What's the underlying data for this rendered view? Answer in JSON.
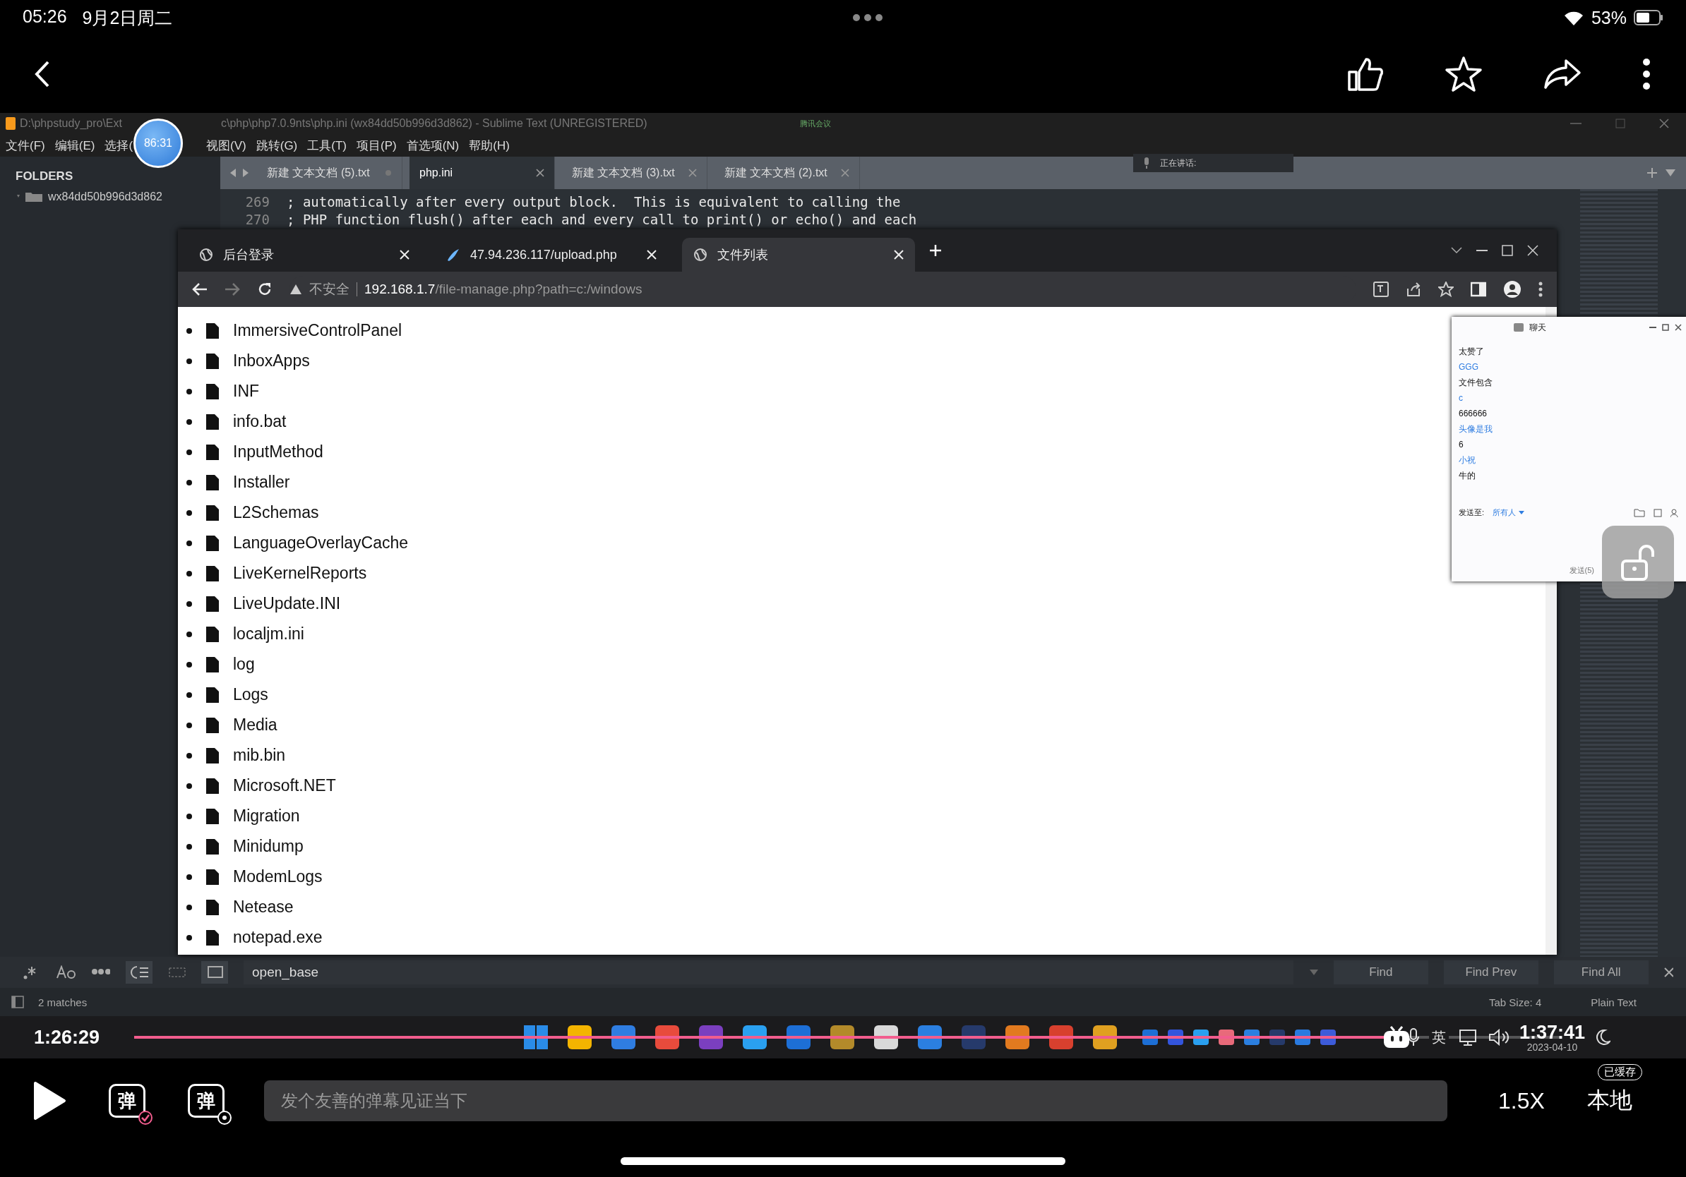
{
  "status_bar": {
    "time": "05:26",
    "date": "9月2日周二",
    "battery": "53%"
  },
  "editor": {
    "title_left": "D:\\phpstudy_pro\\Ext",
    "title_right": "c\\php\\php7.0.9nts\\php.ini (wx84dd50b996d3d862) - Sublime Text (UNREGISTERED)",
    "meeting": "腾讯会议",
    "menu": [
      "文件(F)",
      "编辑(E)",
      "选择(",
      "视图(V)",
      "跳转(G)",
      "工具(T)",
      "项目(P)",
      "首选项(N)",
      "帮助(H)"
    ],
    "folders_heading": "FOLDERS",
    "folder": "wx84dd50b996d3d862",
    "tabs": [
      {
        "label": "新建 文本文档 (5).txt",
        "selected": false,
        "dirty": true
      },
      {
        "label": "php.ini",
        "selected": true,
        "dirty": false
      },
      {
        "label": "新建 文本文档 (3).txt",
        "selected": false,
        "dirty": false
      },
      {
        "label": "新建 文本文档 (2).txt",
        "selected": false,
        "dirty": false
      }
    ],
    "speaking": "正在讲话:",
    "code_lines": [
      {
        "number": "269",
        "text": "; automatically after every output block.  This is equivalent to calling the"
      },
      {
        "number": "270",
        "text": "; PHP function flush() after each and every call to print() or echo() and each"
      }
    ],
    "find": {
      "value": "open_base",
      "buttons": [
        "Find",
        "Find Prev",
        "Find All"
      ]
    },
    "status": {
      "matches": "2 matches",
      "tab_size": "Tab Size: 4",
      "syntax": "Plain Text"
    }
  },
  "timer_bubble": "86:31",
  "browser": {
    "tabs": [
      {
        "title": "后台登录",
        "kind": "globe",
        "selected": false
      },
      {
        "title": "47.94.236.117/upload.php",
        "kind": "fish",
        "selected": false
      },
      {
        "title": "文件列表",
        "kind": "globe",
        "selected": true
      }
    ],
    "security": "不安全",
    "url_host": "192.168.1.7",
    "url_path": "/file-manage.php?path=c:/windows",
    "files": [
      "ImmersiveControlPanel",
      "InboxApps",
      "INF",
      "info.bat",
      "InputMethod",
      "Installer",
      "L2Schemas",
      "LanguageOverlayCache",
      "LiveKernelReports",
      "LiveUpdate.INI",
      "localjm.ini",
      "log",
      "Logs",
      "Media",
      "mib.bin",
      "Microsoft.NET",
      "Migration",
      "Minidump",
      "ModemLogs",
      "Netease",
      "notepad.exe"
    ]
  },
  "chat": {
    "title": "聊天",
    "messages": [
      {
        "kind": "message",
        "text": "太赞了"
      },
      {
        "kind": "name",
        "text": "GGG"
      },
      {
        "kind": "message",
        "text": "文件包含"
      },
      {
        "kind": "name",
        "text": "c"
      },
      {
        "kind": "message",
        "text": "666666"
      },
      {
        "kind": "name",
        "text": "头像是我"
      },
      {
        "kind": "message",
        "text": "6"
      },
      {
        "kind": "name",
        "text": "小祝"
      },
      {
        "kind": "message",
        "text": "牛的"
      }
    ],
    "send_to_label": "发送至:",
    "recipient": "所有人",
    "send_button": "发送(5)"
  },
  "taskbar": {
    "ime": "英",
    "date": "2023-04-10"
  },
  "playback": {
    "elapsed": "1:26:29",
    "total": "1:37:41",
    "level": 0.885
  },
  "controls": {
    "danmaku_buttons": [
      {
        "glyph": "弹",
        "kind": "toggle"
      },
      {
        "glyph": "弹",
        "kind": "settings"
      }
    ],
    "danmaku_placeholder": "发个友善的弹幕见证当下",
    "speed": "1.5X",
    "local": "本地",
    "cached_badge": "已缓存"
  }
}
